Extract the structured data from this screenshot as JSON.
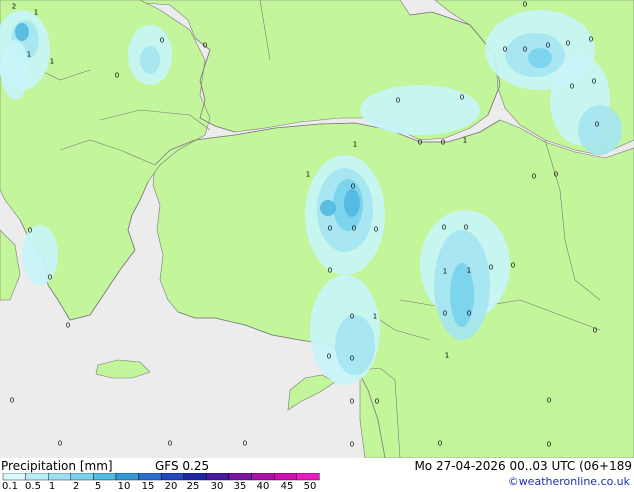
{
  "map": {
    "sea_color": "#ececec",
    "land_color": "#c3f59a",
    "coast_color": "#7a7a7a",
    "precip_levels": [
      "#c8f5fa",
      "#a4e6f2",
      "#78d2ec",
      "#52b8e0",
      "#3c98d2"
    ],
    "values": [
      "2",
      "1",
      "1",
      "1",
      "0",
      "0",
      "0",
      "0",
      "0",
      "0",
      "0",
      "1",
      "0",
      "0",
      "0",
      "0",
      "0",
      "0",
      "0",
      "0",
      "0",
      "0",
      "0",
      "1",
      "1",
      "0",
      "0",
      "0",
      "0",
      "0",
      "0",
      "0",
      "1",
      "1",
      "0",
      "0",
      "0",
      "0",
      "1",
      "0",
      "1",
      "0",
      "0",
      "0",
      "0",
      "0",
      "0",
      "0",
      "0",
      "0",
      "0",
      "0",
      "0",
      "0",
      "0",
      "0",
      "0"
    ]
  },
  "footer": {
    "title": "Precipitation [mm]",
    "model": "GFS 0.25",
    "valid_time": "Mo 27-04-2026 00..03 UTC (06+189",
    "credit": "©weatheronline.co.uk",
    "scale_labels": [
      "0.1",
      "0.5",
      "1",
      "2",
      "5",
      "10",
      "15",
      "20",
      "25",
      "30",
      "35",
      "40",
      "45",
      "50"
    ],
    "scale_colors": [
      "#d7f8fc",
      "#b9eef7",
      "#9ae2f2",
      "#78d3ec",
      "#52bce2",
      "#3498d6",
      "#2d6fc8",
      "#2548b8",
      "#1e259e",
      "#4a1a9c",
      "#7b15a4",
      "#a612ab",
      "#cc10b5",
      "#e41dc4"
    ]
  }
}
